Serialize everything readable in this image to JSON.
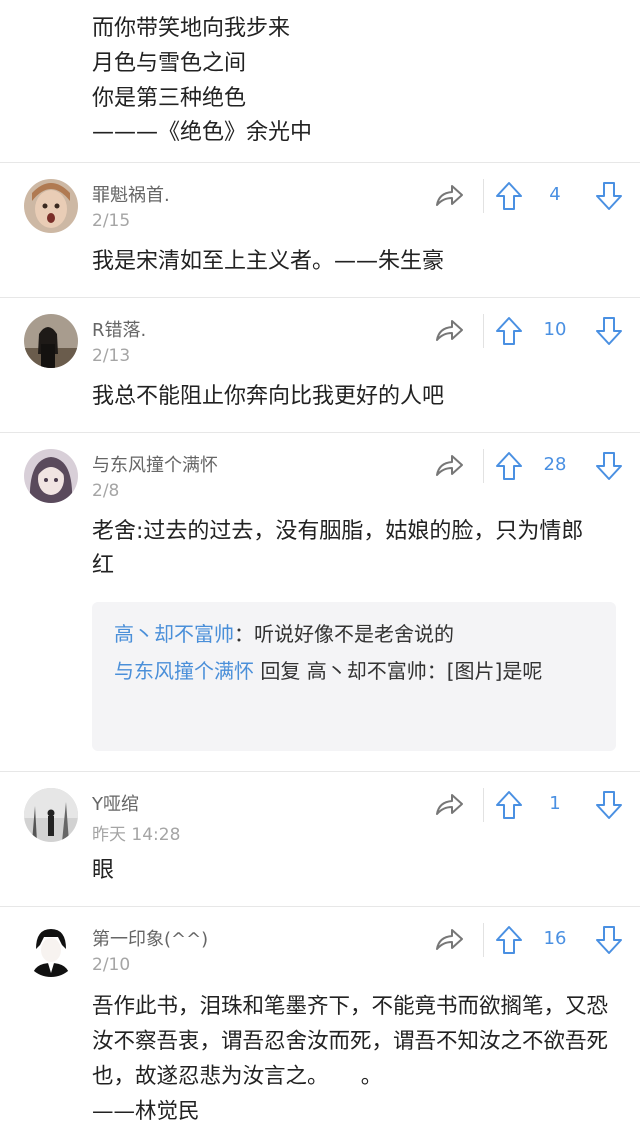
{
  "poem": {
    "lines": [
      "而你带笑地向我步来",
      "月色与雪色之间",
      "你是第三种绝色",
      "———《绝色》余光中"
    ]
  },
  "colors": {
    "accent": "#4a90e2",
    "reply_bg": "#f4f4f6",
    "divider": "#e7e7e7",
    "date_gray": "#a5a5a5"
  },
  "icons": {
    "share": "share-arrow-icon",
    "up": "up-arrow-icon",
    "down": "down-arrow-icon"
  },
  "comments": [
    {
      "username": "罪魁祸首.",
      "date": "2/15",
      "votes": "4",
      "content": "我是宋清如至上主义者。——朱生豪"
    },
    {
      "username": "R错落.",
      "date": "2/13",
      "votes": "10",
      "content": "我总不能阻止你奔向比我更好的人吧"
    },
    {
      "username": "与东风撞个满怀",
      "date": "2/8",
      "votes": "28",
      "content": "老舍:过去的过去，没有胭脂，姑娘的脸，只为情郎红",
      "replies": {
        "r1_name": "高丶却不富帅",
        "r1_sep": "：",
        "r1_text": "听说好像不是老舍说的",
        "r2_name": "与东风撞个满怀",
        "r2_mid": " 回复 ",
        "r2_target": "高丶却不富帅",
        "r2_sep": "：",
        "r2_text": "[图片]是呢"
      }
    },
    {
      "username": "Y哑绾",
      "date": "昨天 14:28",
      "votes": "1",
      "content": "眼"
    },
    {
      "username": "第一印象(^^)",
      "date": "2/10",
      "votes": "16",
      "content": "吾作此书，泪珠和笔墨齐下，不能竟书而欲搁笔，又恐汝不察吾衷，谓吾忍舍汝而死，谓吾不知汝之不欲吾死也，故遂忍悲为汝言之。　　。",
      "content_sig": "——林觉民"
    }
  ]
}
